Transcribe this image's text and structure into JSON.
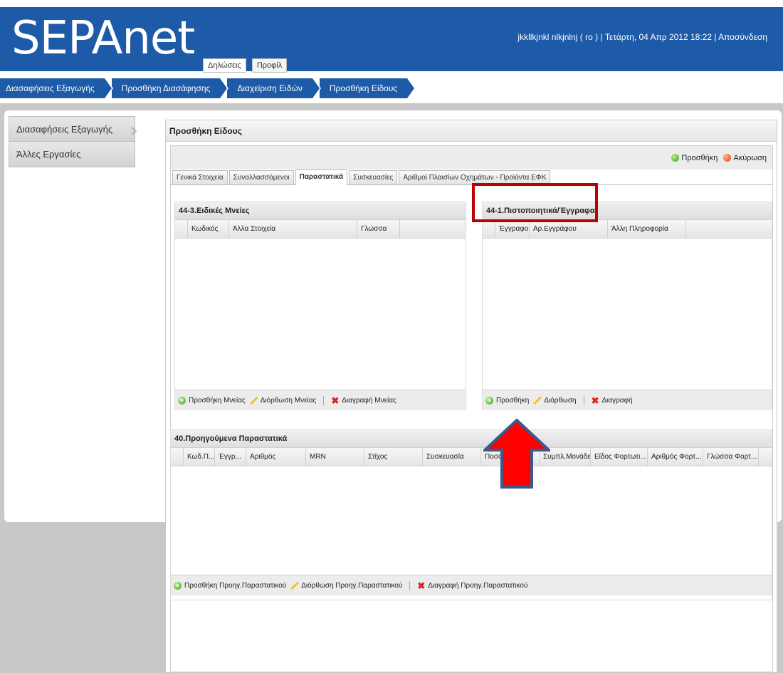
{
  "app": {
    "logo": "SEPAnet",
    "user_info": "jkkllkjnkl nlkjnlnj ( ro ) | Τετάρτη, 04 Απρ 2012 18:22 | Αποσύνδεση",
    "top_tabs": [
      "Δηλώσεις",
      "Προφίλ"
    ]
  },
  "breadcrumb": [
    "Διασαφήσεις Εξαγωγής",
    "Προσθήκη Διασάφησης",
    "Διαχείριση Ειδών",
    "Προσθήκη Είδους"
  ],
  "sidebar": {
    "items": [
      "Διασαφήσεις Εξαγωγής",
      "Άλλες Εργασίες"
    ]
  },
  "form": {
    "title": "Προσθήκη Είδους",
    "add_label": "Προσθήκη",
    "cancel_label": "Ακύρωση",
    "tabs": [
      "Γενικά Στοιχεία",
      "Συναλλασσόμενοι",
      "Παραστατικά",
      "Συσκευασίες",
      "Αριθμοί Πλαισίων Οχημάτων - Προϊόντα ΕΦΚ"
    ],
    "active_tab": "Παραστατικά"
  },
  "special_mentions": {
    "title": "44-3.Ειδικές Μνείες",
    "columns": [
      "Κωδικός",
      "Άλλα Στοιχεία",
      "Γλώσσα"
    ],
    "toolbar": {
      "add": "Προσθήκη Μνείας",
      "edit": "Διόρθωση Μνείας",
      "delete": "Διαγραφή Μνείας"
    }
  },
  "certificates": {
    "title": "44-1.Πιστοποιητικά/Έγγραφα",
    "columns": [
      "Έγγραφο",
      "Αρ.Εγγράφου",
      "Άλλη Πληροφορία"
    ],
    "toolbar": {
      "add": "Προσθήκη",
      "edit": "Διόρθωση",
      "delete": "Διαγραφή"
    }
  },
  "previous_docs": {
    "title": "40.Προηγούμενα Παραστατικά",
    "columns": [
      "Κωδ.Π...",
      "Έγγρ...",
      "Αριθμός",
      "MRN",
      "Στίχος",
      "Συσκευασία",
      "Ποσότητα",
      "Συμπλ.Μονάδες",
      "Είδος Φορτωτι...",
      "Αριθμός Φορτ...",
      "Γλώσσα Φορτ..."
    ],
    "toolbar": {
      "add": "Προσθήκη Προηγ.Παραστατικού",
      "edit": "Διόρθωση Προηγ.Παραστατικού",
      "delete": "Διαγραφή Προηγ.Παραστατικού"
    }
  },
  "colors": {
    "brand_blue": "#1d5aa8",
    "highlight_red": "#c00000",
    "arrow_red": "#ff0000",
    "arrow_outline": "#3a5a90"
  }
}
